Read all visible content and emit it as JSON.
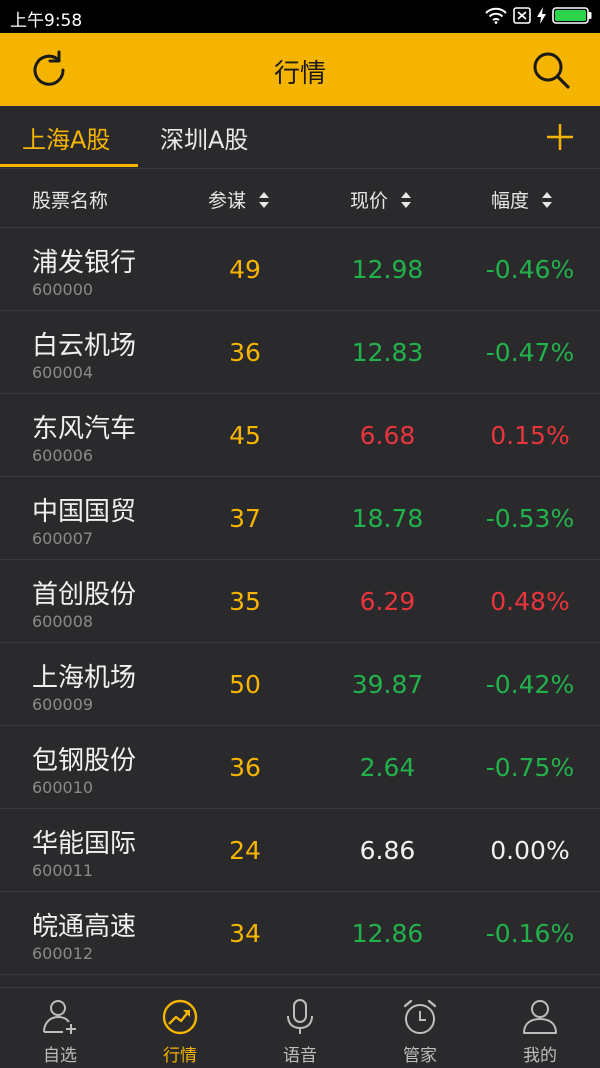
{
  "status_bar": {
    "time": "上午9:58",
    "icons": [
      "wifi-icon",
      "sim-x-icon",
      "charging-icon",
      "battery-icon"
    ]
  },
  "header": {
    "title": "行情",
    "left_icon": "refresh-icon",
    "right_icon": "search-icon"
  },
  "tabs": [
    {
      "label": "上海A股",
      "active": true
    },
    {
      "label": "深圳A股",
      "active": false
    }
  ],
  "columns": {
    "name": "股票名称",
    "can": "参谋",
    "price": "现价",
    "change": "幅度"
  },
  "rows": [
    {
      "name": "浦发银行",
      "code": "600000",
      "can": "49",
      "price": "12.98",
      "change": "-0.46%",
      "trend": "down"
    },
    {
      "name": "白云机场",
      "code": "600004",
      "can": "36",
      "price": "12.83",
      "change": "-0.47%",
      "trend": "down"
    },
    {
      "name": "东风汽车",
      "code": "600006",
      "can": "45",
      "price": "6.68",
      "change": "0.15%",
      "trend": "up"
    },
    {
      "name": "中国国贸",
      "code": "600007",
      "can": "37",
      "price": "18.78",
      "change": "-0.53%",
      "trend": "down"
    },
    {
      "name": "首创股份",
      "code": "600008",
      "can": "35",
      "price": "6.29",
      "change": "0.48%",
      "trend": "up"
    },
    {
      "name": "上海机场",
      "code": "600009",
      "can": "50",
      "price": "39.87",
      "change": "-0.42%",
      "trend": "down"
    },
    {
      "name": "包钢股份",
      "code": "600010",
      "can": "36",
      "price": "2.64",
      "change": "-0.75%",
      "trend": "down"
    },
    {
      "name": "华能国际",
      "code": "600011",
      "can": "24",
      "price": "6.86",
      "change": "0.00%",
      "trend": "flat"
    },
    {
      "name": "皖通高速",
      "code": "600012",
      "can": "34",
      "price": "12.86",
      "change": "-0.16%",
      "trend": "down"
    }
  ],
  "bottom_nav": [
    {
      "label": "自选",
      "icon": "add-user-icon",
      "active": false
    },
    {
      "label": "行情",
      "icon": "trend-icon",
      "active": true
    },
    {
      "label": "语音",
      "icon": "microphone-icon",
      "active": false
    },
    {
      "label": "管家",
      "icon": "alarm-clock-icon",
      "active": false
    },
    {
      "label": "我的",
      "icon": "profile-icon",
      "active": false
    }
  ],
  "colors": {
    "accent": "#f5b400",
    "up": "#e8343a",
    "down": "#22b24c",
    "background": "#2a2a2c"
  }
}
